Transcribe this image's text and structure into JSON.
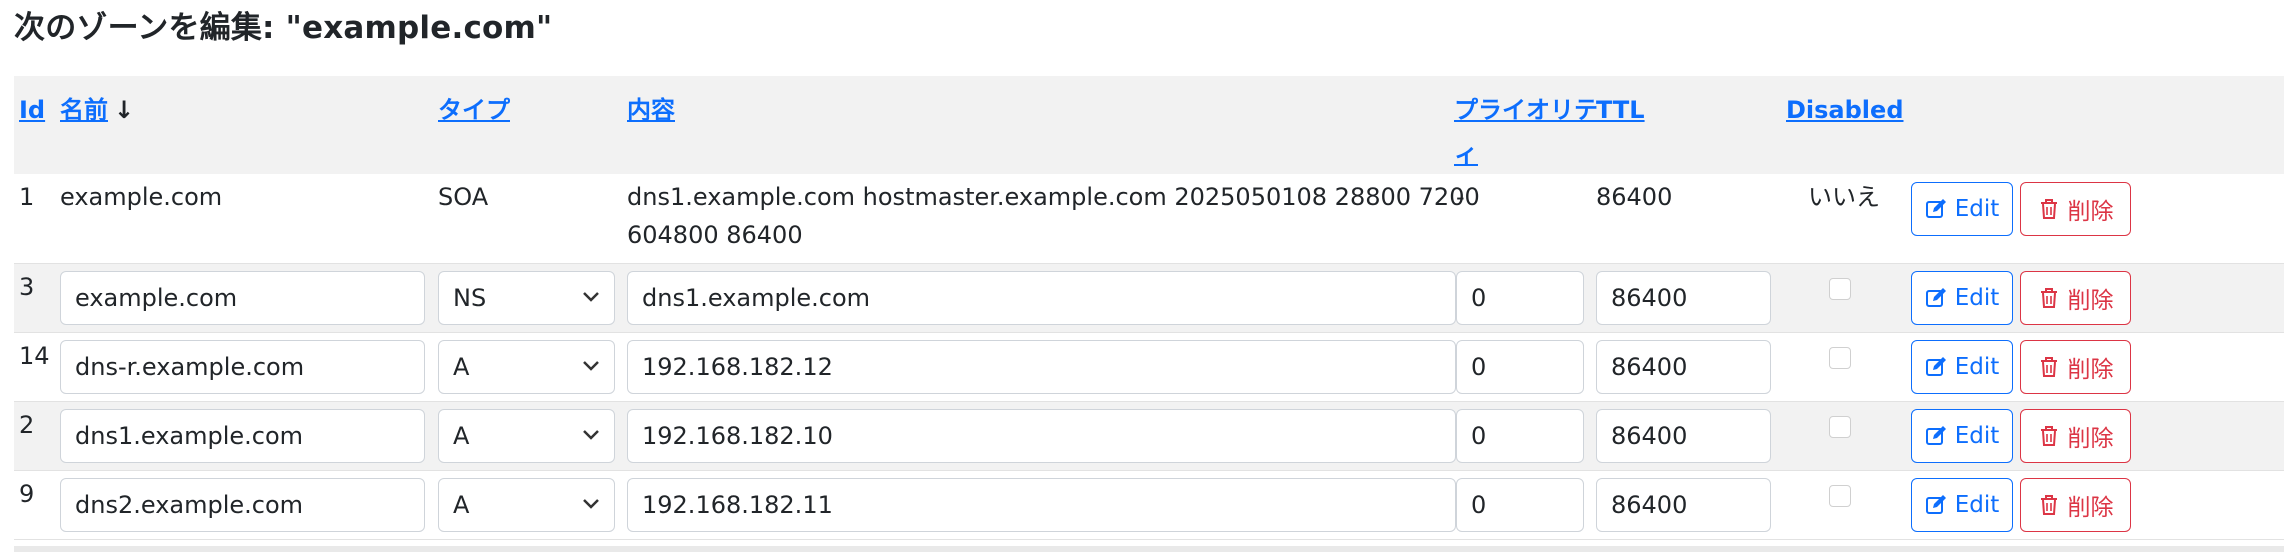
{
  "page": {
    "title": "次のゾーンを編集: \"example.com\""
  },
  "table": {
    "headers": {
      "id": "Id",
      "name": "名前",
      "sort_indicator": "↓",
      "type": "タイプ",
      "content": "内容",
      "priority_line1": "プライオリテ",
      "priority_line2": "ィ",
      "ttl": "TTL",
      "disabled": "Disabled"
    },
    "soa": {
      "id": "1",
      "name": "example.com",
      "type": "SOA",
      "content_line1": "dns1.example.com hostmaster.example.com 2025050108 28800 7200",
      "content_line2": "604800 86400",
      "priority": "-",
      "ttl": "86400",
      "disabled": "いいえ"
    },
    "rows": [
      {
        "id": "3",
        "name": "example.com",
        "type": "NS",
        "content": "dns1.example.com",
        "priority": "0",
        "ttl": "86400",
        "disabled": false
      },
      {
        "id": "14",
        "name": "dns-r.example.com",
        "type": "A",
        "content": "192.168.182.12",
        "priority": "0",
        "ttl": "86400",
        "disabled": false
      },
      {
        "id": "2",
        "name": "dns1.example.com",
        "type": "A",
        "content": "192.168.182.10",
        "priority": "0",
        "ttl": "86400",
        "disabled": false
      },
      {
        "id": "9",
        "name": "dns2.example.com",
        "type": "A",
        "content": "192.168.182.11",
        "priority": "0",
        "ttl": "86400",
        "disabled": false
      }
    ],
    "actions": {
      "edit_label": "Edit",
      "delete_label": "削除"
    }
  },
  "icons": {
    "edit": "edit-icon",
    "delete": "trash-icon",
    "select": "chevron-down-icon"
  },
  "colors": {
    "link": "#0d6efd",
    "danger": "#dc3545",
    "row_shade": "#f2f2f2"
  }
}
